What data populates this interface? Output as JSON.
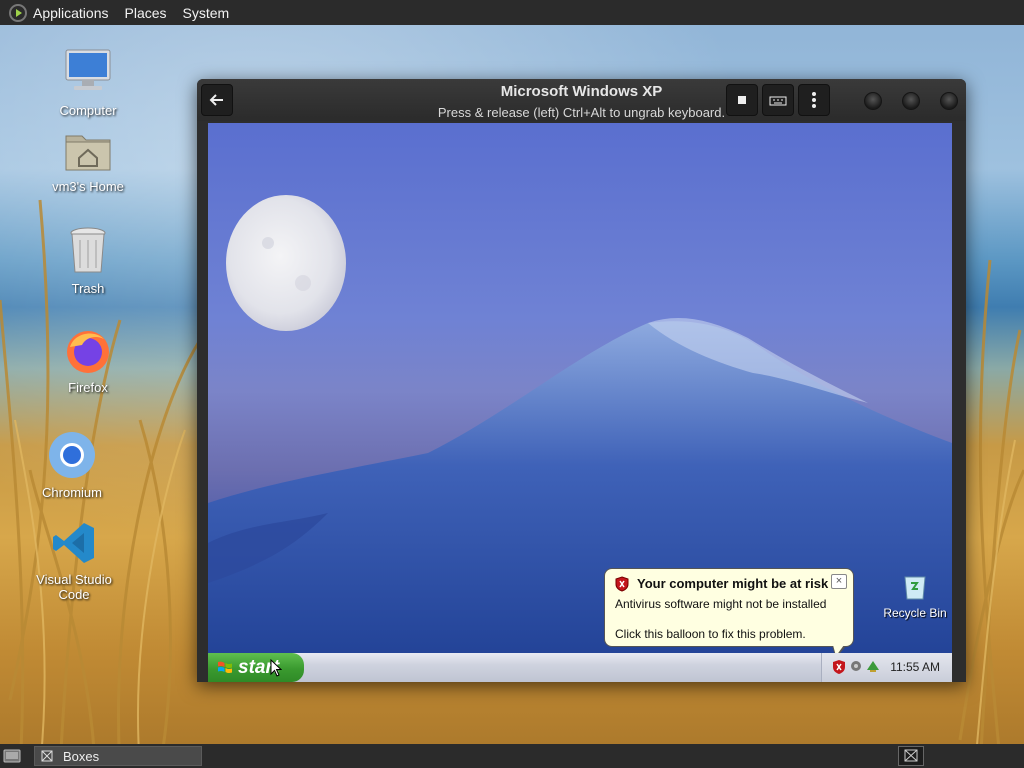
{
  "top_panel": {
    "menus": [
      "Applications",
      "Places",
      "System"
    ]
  },
  "desktop_icons": [
    {
      "label": "Computer",
      "icon": "computer-icon"
    },
    {
      "label": "vm3's Home",
      "icon": "home-folder-icon"
    },
    {
      "label": "Trash",
      "icon": "trash-icon"
    },
    {
      "label": "Firefox",
      "icon": "firefox-icon"
    },
    {
      "label": "Chromium",
      "icon": "chromium-icon"
    },
    {
      "label": "Visual Studio Code",
      "icon": "vscode-icon"
    }
  ],
  "vm_window": {
    "title": "Microsoft Windows XP",
    "subtitle": "Press & release (left) Ctrl+Alt to ungrab keyboard.",
    "buttons": [
      "back-icon",
      "stop-icon",
      "keyboard-icon",
      "menu-dots-icon"
    ]
  },
  "xp": {
    "start_label": "start",
    "recycle_bin_label": "Recycle Bin",
    "clock": "11:55 AM",
    "balloon": {
      "title": "Your computer might be at risk",
      "line1": "Antivirus software might not be installed",
      "line2": "Click this balloon to fix this problem.",
      "close": "×"
    }
  },
  "bottom_panel": {
    "task_label": "Boxes"
  },
  "colors": {
    "panel": "#2b2b2b",
    "xp_start_green": "#3a9a2f",
    "balloon_bg": "#ffffe1"
  }
}
